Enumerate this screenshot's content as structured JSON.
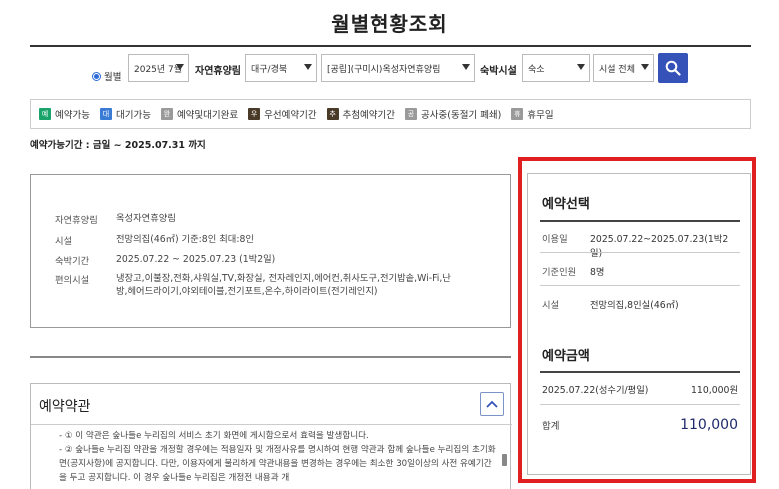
{
  "page": {
    "title": "월별현황조회"
  },
  "filters": {
    "radio_label": "월별",
    "month": "2025년 7월",
    "forest_label": "자연휴양림",
    "region": "대구/경북",
    "forest": "[공립](구미시)옥성자연휴양림",
    "facility_label": "숙박시설",
    "facility_type": "숙소",
    "facility_all": "시설 전체"
  },
  "legend": [
    {
      "badge": "예",
      "label": "예약가능",
      "color": "#1aa36b"
    },
    {
      "badge": "대",
      "label": "대기가능",
      "color": "#3a7bd5"
    },
    {
      "badge": "완",
      "label": "예약및대기완료",
      "color": "#9a9a9a"
    },
    {
      "badge": "우",
      "label": "우선예약기간",
      "color": "#4a3a28"
    },
    {
      "badge": "추",
      "label": "추첨예약기간",
      "color": "#4a3a28"
    },
    {
      "badge": "공",
      "label": "공사중(동절기 폐쇄)",
      "color": "#9a9a9a"
    },
    {
      "badge": "휴",
      "label": "휴무일",
      "color": "#9a9a9a"
    }
  ],
  "period_text": "예약가능기간 : 금일 ~ 2025.07.31 까지",
  "info": {
    "forest_k": "자연휴양림",
    "forest_v": "옥성자연휴양림",
    "facility_k": "시설",
    "facility_v": "전망의집(46㎡) 기준:8인 최대:8인",
    "stay_k": "숙박기간",
    "stay_v": "2025.07.22 ~ 2025.07.23 (1박2일)",
    "amenity_k": "편의시설",
    "amenity_v": "냉장고,이불장,전화,샤워실,TV,화장실, 전자레인지,에어컨,취사도구,전기밥솥,Wi-Fi,난방,헤어드라이기,야외테이블,전기포트,온수,하이라이트(전기레인지)"
  },
  "terms": {
    "title": "예약약관",
    "lines": [
      "- ① 이 약관은 숲나들e 누리집의 서비스 초기 화면에 게시함으로서 효력을 발생합니다.",
      "- ② 숲나들e 누리집 약관을 개정할 경우에는 적용일자 및 개정사유를 명시하여 현행 약관과 함께 숲나들e 누리집의 초기화면(공지사항)에 공지합니다. 다만, 이용자에게 불리하게 약관내용을 변경하는 경우에는 최소한 30일이상의 사전 유예기간을 두고 공지합니다. 이 경우 숲나들e 누리집은 개정전 내용과 개"
    ]
  },
  "reservation": {
    "select_title": "예약선택",
    "date_k": "이용일",
    "date_v": "2025.07.22~2025.07.23(1박2일)",
    "people_k": "기준인원",
    "people_v": "8명",
    "facility_k": "시설",
    "facility_v": "전망의집,8인실(46㎡)",
    "amount_title": "예약금액",
    "price_date": "2025.07.22(성수기/평일)",
    "price_value": "110,000원",
    "total_k": "합계",
    "total_v": "110,000"
  }
}
